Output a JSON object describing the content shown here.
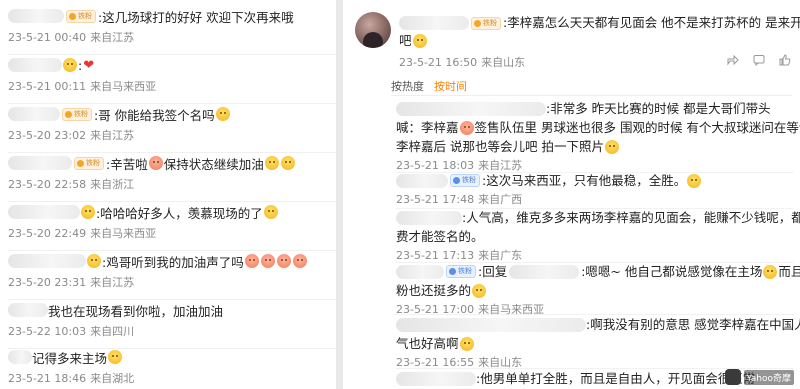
{
  "left_comments": [
    {
      "text_a": ":这几场球打的好好 欢迎下次再来哦",
      "time": "23-5-21 00:40",
      "location": "来自江苏"
    },
    {
      "text_a": ":",
      "time": "23-5-21 00:11",
      "location": "来自马来西亚"
    },
    {
      "text_a": ":哥 你能给我签个名吗",
      "time": "23-5-20 23:02",
      "location": "来自江苏"
    },
    {
      "text_a": ":辛苦啦",
      "text_b": "保持状态继续加油",
      "time": "23-5-20 22:58",
      "location": "来自浙江"
    },
    {
      "text_a": ":哈哈哈好多人，羡慕现场的了",
      "time": "23-5-20 22:49",
      "location": "来自马来西亚"
    },
    {
      "text_a": ":鸡哥听到我的加油声了吗",
      "time": "23-5-20 23:31",
      "location": "来自江苏"
    },
    {
      "text_a": "我也在现场看到你啦，加油加油",
      "time": "23-5-22 10:03",
      "location": "来自四川"
    },
    {
      "text_a": "记得多来主场",
      "time": "23-5-21 18:46",
      "location": "来自湖北"
    }
  ],
  "post": {
    "text_line1": ":李梓嘉怎么天天都有见面会 他不是来打苏杯的 是来开见面会的",
    "text_line2": "吧",
    "time": "23-5-21 16:50",
    "location": "来自山东"
  },
  "sort": {
    "hot": "按热度",
    "time": "按时间"
  },
  "right_comments": [
    {
      "lines": [
        ":非常多 昨天比赛的时候 都是大哥们带头",
        "喊：李梓嘉",
        "签售队伍里 男球迷也很多 围观的时候 有个大叔球迷问在等谁 知道是",
        "李梓嘉后 说那也等会儿吧 拍一下照片"
      ],
      "time": "23-5-21 18:03",
      "location": "来自江苏"
    },
    {
      "lines": [
        ":这次马来西亚，只有他最稳，全胜。"
      ],
      "time": "23-5-21 17:48",
      "location": "来自广西"
    },
    {
      "lines": [
        ":人气高，维克多多来两场李梓嘉的见面会，能赚不少钱呢，都要消",
        "费才能签名的。"
      ],
      "time": "23-5-21 17:13",
      "location": "来自广东"
    },
    {
      "lines": [
        ":回复",
        ":嗯嗯~ 他自己都说感觉像在主场",
        "而且男",
        "粉也还挺多的"
      ],
      "time": "23-5-21 17:00",
      "location": "来自马来西亚"
    },
    {
      "lines": [
        ":啊我没有别的意思 感觉李梓嘉在中国人",
        "气也好高啊"
      ],
      "time": "23-5-21 16:55",
      "location": "来自山东"
    },
    {
      "lines": [
        ":他男单单打全胜，而且是自由人，开见面会很正常"
      ],
      "time": "",
      "location": ""
    }
  ],
  "badge_text": "铁粉",
  "watermark": "Yahoo奇摩"
}
